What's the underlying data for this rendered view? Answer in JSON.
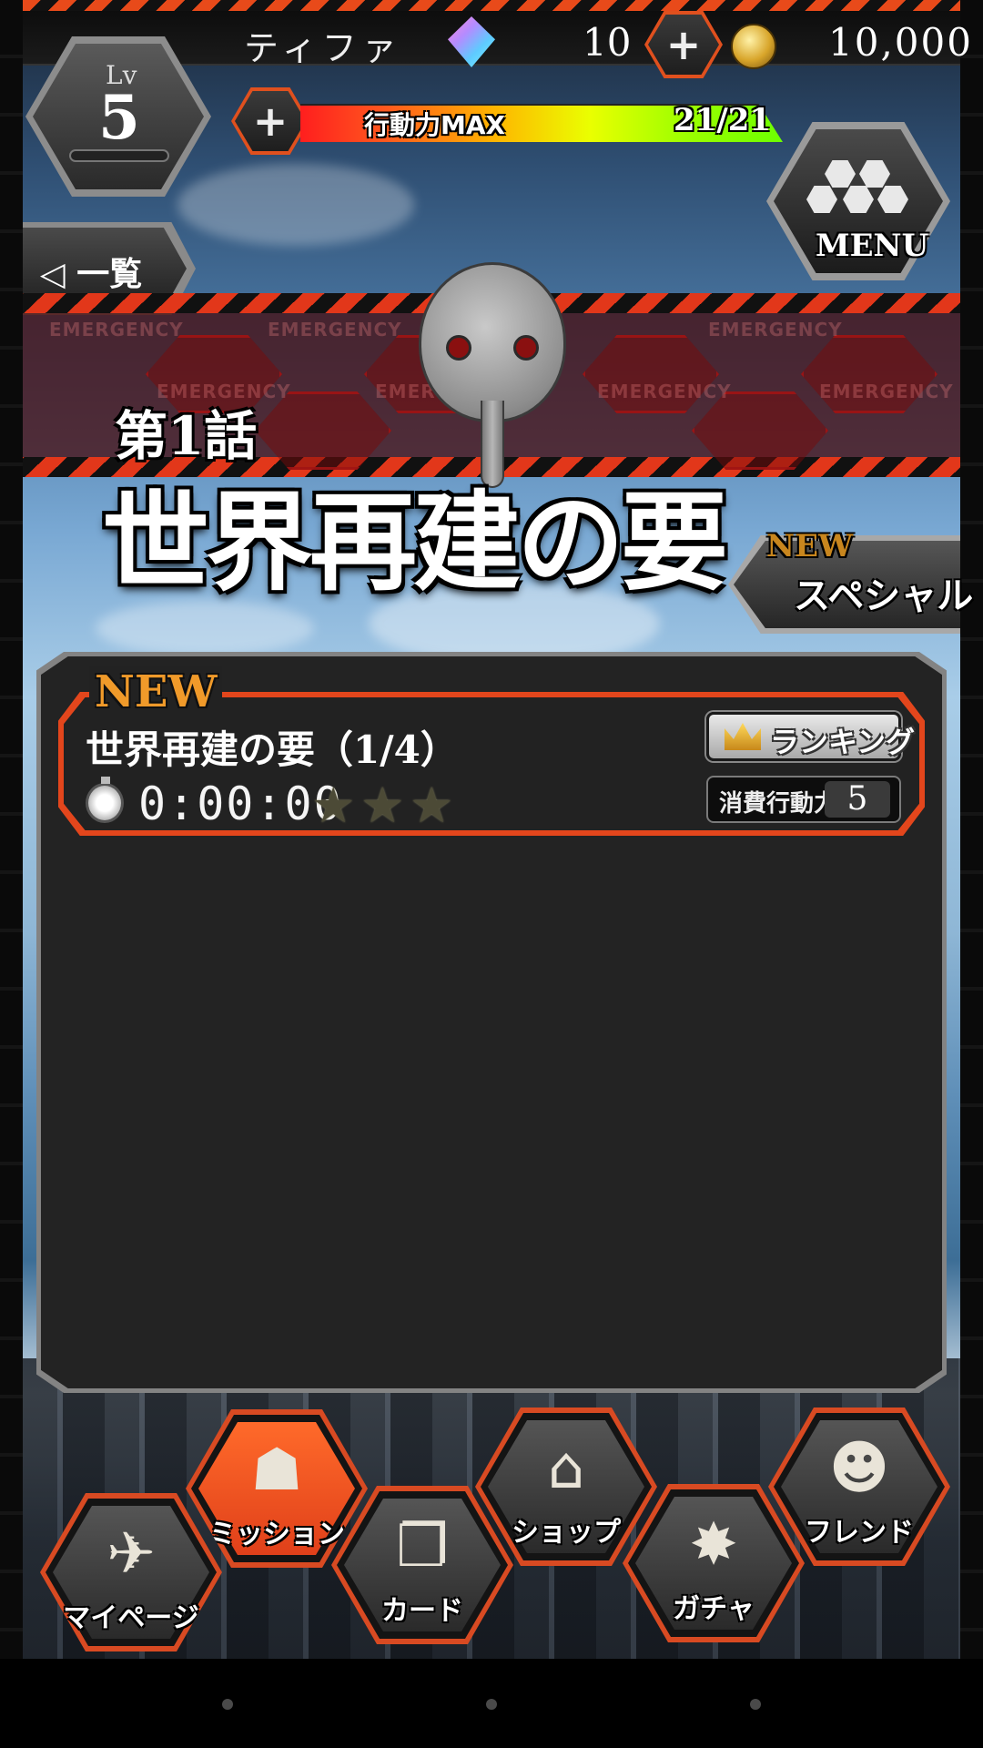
{
  "header": {
    "player_name": "ティファ",
    "gem_count": "10",
    "coin_count": "10,000",
    "level_label": "Lv",
    "level_value": "5",
    "stamina_label": "行動力MAX",
    "stamina_value": "21/21",
    "stamina_fraction": 1.0,
    "menu_label": "MENU"
  },
  "nav_back": {
    "label": "◁ 一覧"
  },
  "banner": {
    "emergency_text": "EMERGENCY",
    "episode_number": "第1話",
    "episode_title": "世界再建の要"
  },
  "special": {
    "new_badge": "NEW",
    "label": "スペシャル"
  },
  "stage": {
    "new_badge": "NEW",
    "title": "世界再建の要（1/4）",
    "clear_time": "0:00:00",
    "stars_earned": 0,
    "stars_total": 3,
    "ranking_label": "ランキング",
    "cost_label": "消費行動力",
    "cost_value": "5"
  },
  "bottom_nav": {
    "items": [
      {
        "label": "マイページ",
        "icon": "nerv-icon",
        "active": false
      },
      {
        "label": "ミッション",
        "icon": "mission-mask-icon",
        "active": true
      },
      {
        "label": "カード",
        "icon": "cards-icon",
        "active": false
      },
      {
        "label": "ショップ",
        "icon": "shop-icon",
        "active": false
      },
      {
        "label": "ガチャ",
        "icon": "gacha-icon",
        "active": false
      },
      {
        "label": "フレンド",
        "icon": "friend-icon",
        "active": false
      }
    ]
  },
  "colors": {
    "accent_orange": "#e3461c",
    "new_badge": "#f09a2a",
    "panel_bg": "#232323"
  }
}
